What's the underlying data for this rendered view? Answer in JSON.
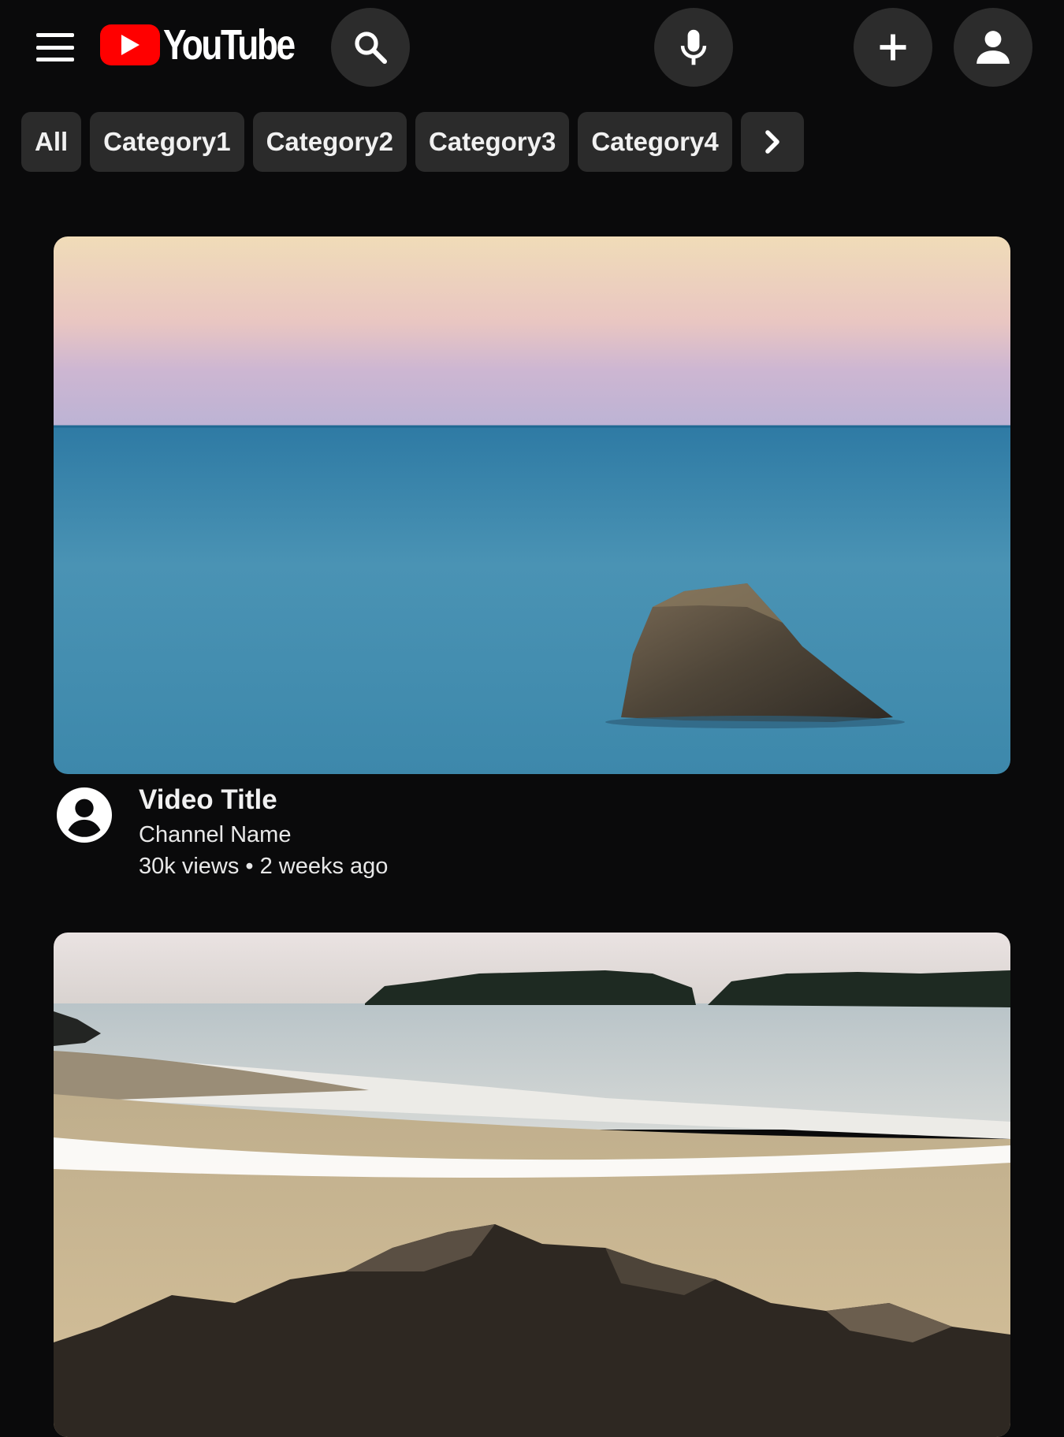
{
  "header": {
    "logo_text": "YouTube",
    "brand_color": "#ff0000",
    "icons": [
      "menu-icon",
      "search-icon",
      "microphone-icon",
      "plus-icon",
      "account-icon"
    ]
  },
  "chips": [
    "All",
    "Category1",
    "Category2",
    "Category3",
    "Category4"
  ],
  "chips_next_icon": "chevron-right-icon",
  "videos": [
    {
      "title": "Video Title",
      "channel": "Channel Name",
      "views": "30k views",
      "separator": "•",
      "age": "2 weeks ago"
    }
  ]
}
